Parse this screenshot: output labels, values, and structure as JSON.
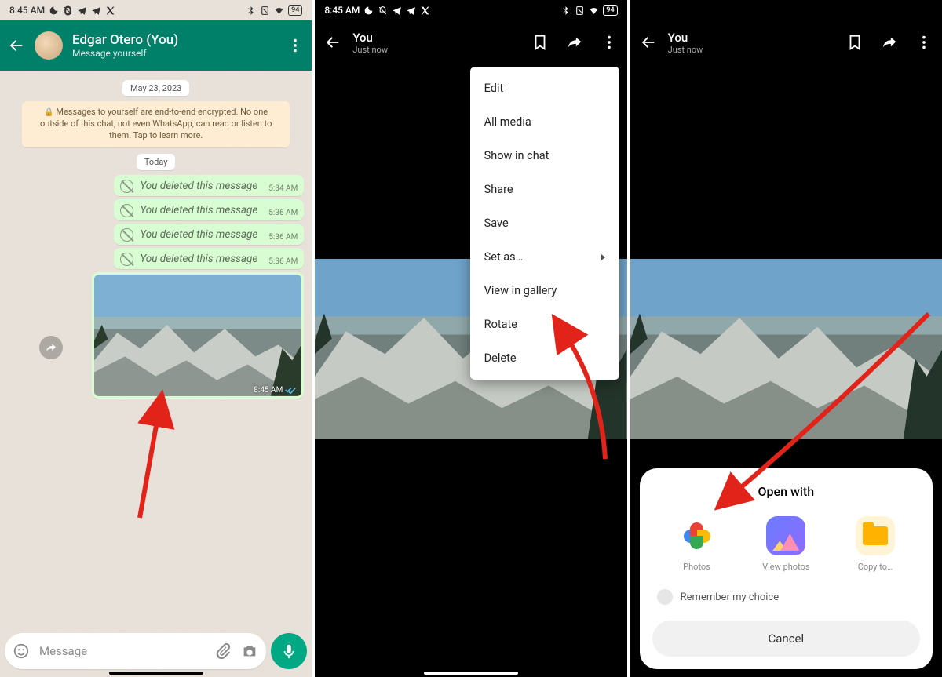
{
  "status": {
    "time": "8:45 AM",
    "battery": "94"
  },
  "panel1": {
    "header": {
      "title": "Edgar Otero (You)",
      "subtitle": "Message yourself"
    },
    "date1": "May 23, 2023",
    "encrypt": "Messages to yourself are end-to-end encrypted. No one outside of this chat, not even WhatsApp, can read or listen to them. Tap to learn more.",
    "date2": "Today",
    "deleted": "You deleted this message",
    "times": [
      "5:34 AM",
      "5:36 AM",
      "5:36 AM",
      "5:36 AM"
    ],
    "imgTime": "8:45 AM",
    "placeholder": "Message"
  },
  "panel2": {
    "title": "You",
    "subtitle": "Just now",
    "menu": [
      "Edit",
      "All media",
      "Show in chat",
      "Share",
      "Save",
      "Set as…",
      "View in gallery",
      "Rotate",
      "Delete"
    ]
  },
  "panel3": {
    "title": "You",
    "subtitle": "Just now",
    "sheet": {
      "heading": "Open with",
      "apps": [
        "Photos",
        "View photos",
        "Copy to…"
      ],
      "remember": "Remember my choice",
      "cancel": "Cancel"
    }
  }
}
